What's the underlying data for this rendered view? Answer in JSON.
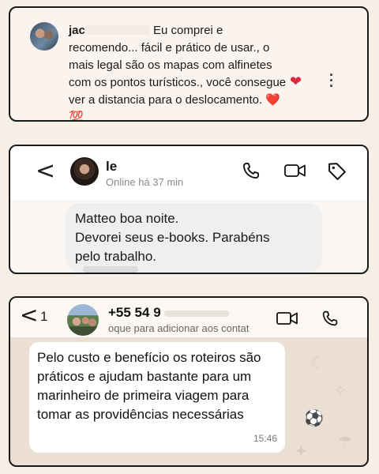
{
  "card1": {
    "author_prefix": "jac",
    "text_first_line": " Eu comprei e",
    "text_rest": "recomendo... fácil e prático de usar., o mais legal são os mapas com alfinetes com os pontos turísticos., você consegue ver a distancia para o deslocamento. ❤️💯",
    "like_icon": "heart-icon",
    "more_icon": "more-vertical-icon"
  },
  "card2": {
    "back_glyph": "<",
    "name": "le",
    "status": "Online há 37 min",
    "message_lines": [
      "Matteo boa noite.",
      "Devorei seus e-books. Parabéns",
      "pelo trabalho."
    ]
  },
  "card3": {
    "back_glyph": "<",
    "unread_count": "1",
    "phone": "+55 54 9",
    "hint": "oque para adicionar aos contat",
    "message": "Pelo custo e benefício os roteiros são práticos e ajudam bastante para um marinheiro de primeira viagem para tomar as providências necessárias",
    "time": "15:46"
  }
}
